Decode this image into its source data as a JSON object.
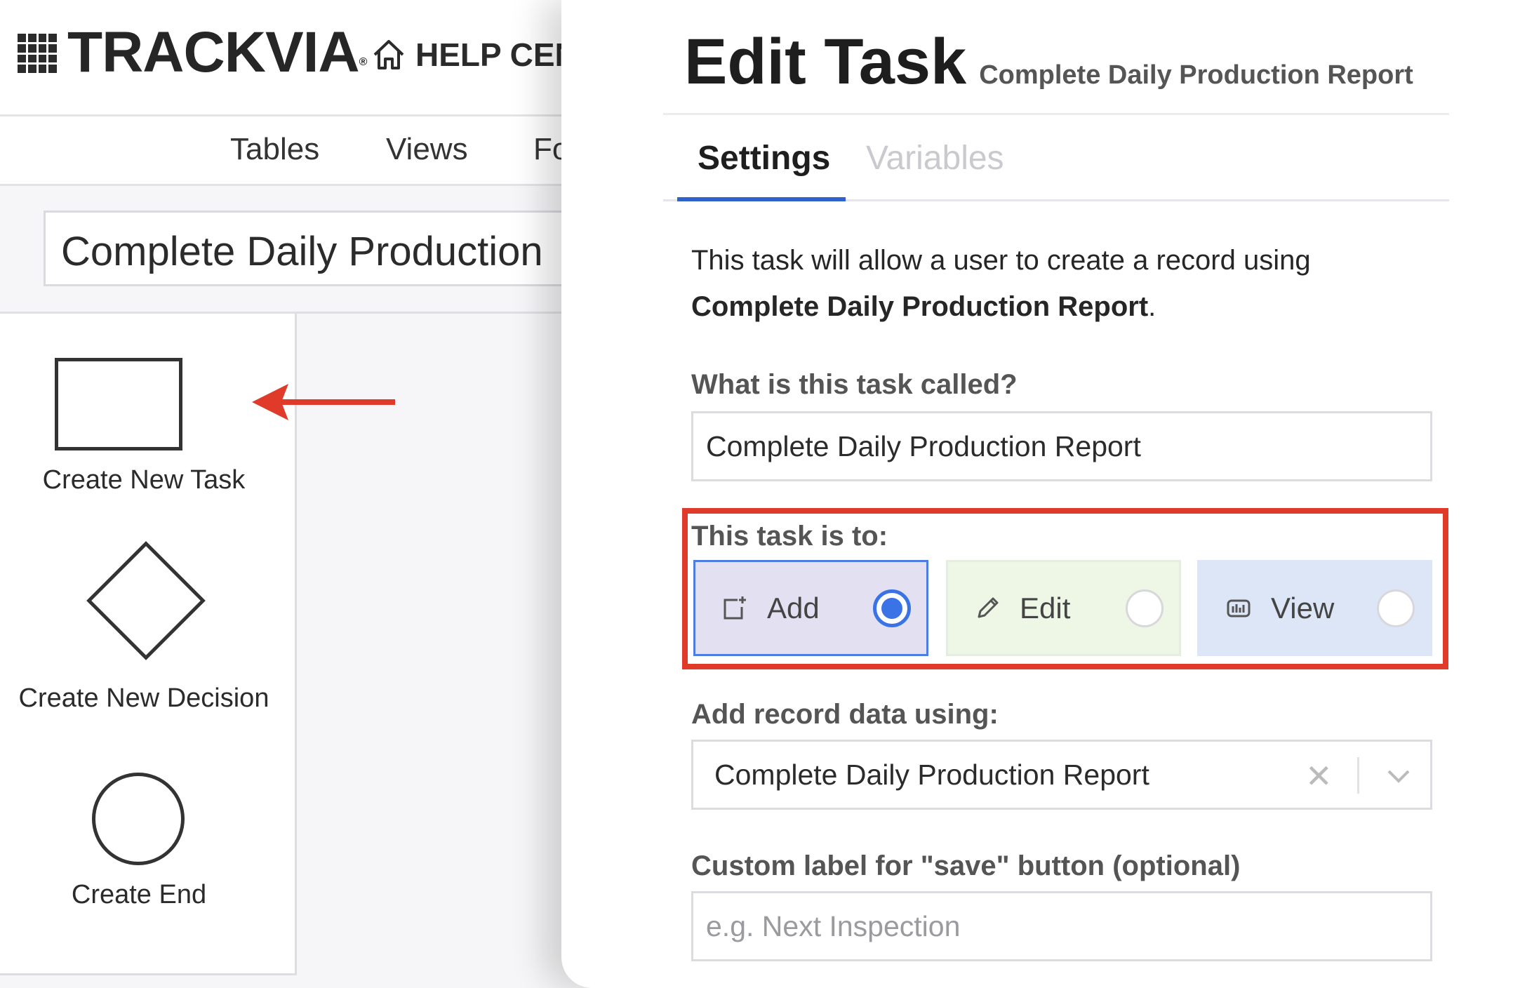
{
  "app": {
    "logo_text": "TRACKVIA",
    "logo_mark": "®",
    "help_label": "HELP CEN"
  },
  "nav": {
    "items": [
      "Tables",
      "Views",
      "Fo"
    ]
  },
  "workflow": {
    "title": "Complete Daily Production"
  },
  "palette": {
    "task_label": "Create New Task",
    "decision_label": "Create New Decision",
    "end_label": "Create End"
  },
  "drawer": {
    "title": "Edit Task",
    "subtitle": "Complete Daily Production Report",
    "tabs": [
      {
        "label": "Settings",
        "active": true
      },
      {
        "label": "Variables",
        "active": false
      }
    ],
    "description_prefix": "This task will allow a user to create a record using",
    "description_form": "Complete Daily Production Report",
    "description_suffix": ".",
    "name_label": "What is this task called?",
    "name_value": "Complete Daily Production Report",
    "task_type_label": "This task is to:",
    "task_types": [
      {
        "label": "Add",
        "icon": "add-record-icon",
        "selected": true
      },
      {
        "label": "Edit",
        "icon": "pencil-icon",
        "selected": false
      },
      {
        "label": "View",
        "icon": "view-icon",
        "selected": false
      }
    ],
    "data_source_label": "Add record data using:",
    "data_source_value": "Complete Daily Production Report",
    "save_label_label": "Custom label for \"save\" button (optional)",
    "save_label_placeholder": "e.g. Next Inspection"
  },
  "colors": {
    "accent": "#2f63c9",
    "highlight": "#e03a2a",
    "add_bg": "#e3e1f1",
    "edit_bg": "#eef7e6",
    "view_bg": "#dde6f6"
  }
}
